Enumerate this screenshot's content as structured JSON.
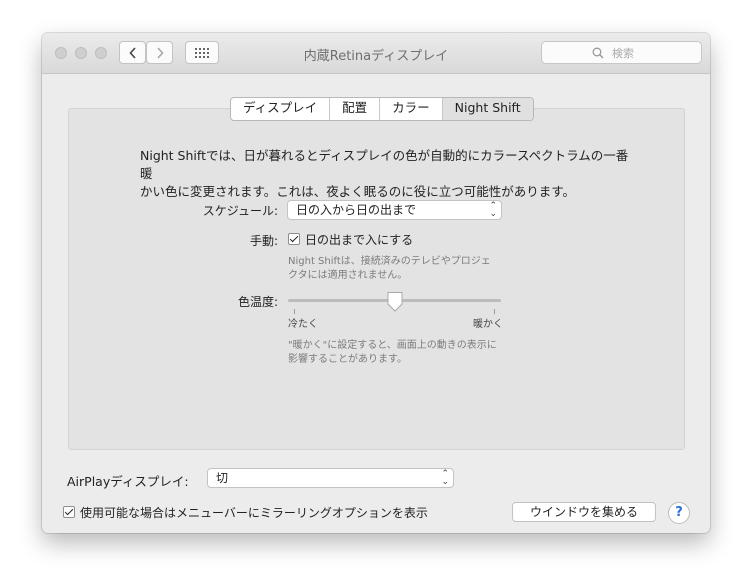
{
  "window": {
    "title": "内蔵Retinaディスプレイ",
    "search_placeholder": "検索"
  },
  "tabs": [
    {
      "label": "ディスプレイ",
      "selected": false
    },
    {
      "label": "配置",
      "selected": false
    },
    {
      "label": "カラー",
      "selected": false
    },
    {
      "label": "Night Shift",
      "selected": true
    }
  ],
  "night_shift": {
    "description_line1": "Night Shiftでは、日が暮れるとディスプレイの色が自動的にカラースペクトラムの一番暖",
    "description_line2": "かい色に変更されます。これは、夜よく眠るのに役に立つ可能性があります。",
    "schedule_label": "スケジュール:",
    "schedule_value": "日の入から日の出まで",
    "manual_label": "手動:",
    "manual_checkbox_label": "日の出まで入にする",
    "manual_checked": true,
    "manual_note_line1": "Night Shiftは、接続済みのテレビやプロジェ",
    "manual_note_line2": "クタには適用されません。",
    "temperature_label": "色温度:",
    "slider_min_label": "冷たく",
    "slider_max_label": "暖かく",
    "slider_value_fraction": 0.5,
    "temperature_note_line1": "\"暖かく\"に設定すると、画面上の動きの表示に",
    "temperature_note_line2": "影響することがあります。"
  },
  "airplay": {
    "label": "AirPlayディスプレイ:",
    "value": "切"
  },
  "mirroring": {
    "checkbox_label": "使用可能な場合はメニューバーにミラーリングオプションを表示",
    "checked": true
  },
  "gather_windows_button": "ウインドウを集める",
  "help_label": "?"
}
